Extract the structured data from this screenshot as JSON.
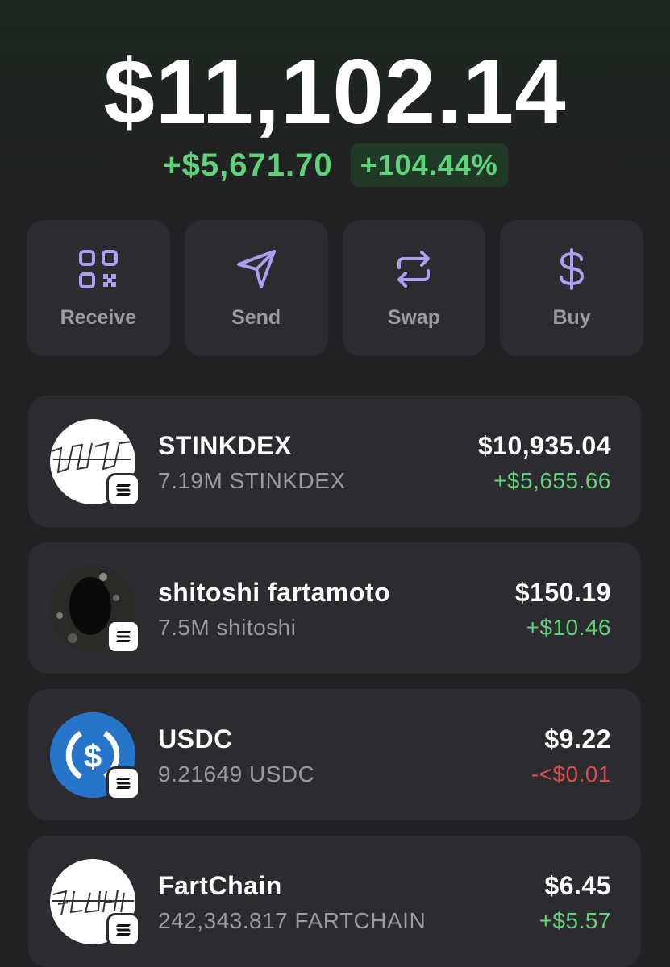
{
  "portfolio": {
    "balance": "$11,102.14",
    "change_abs": "+$5,671.70",
    "change_pct": "+104.44%"
  },
  "actions": [
    {
      "label": "Receive",
      "icon": "qr-code-icon"
    },
    {
      "label": "Send",
      "icon": "send-icon"
    },
    {
      "label": "Swap",
      "icon": "swap-icon"
    },
    {
      "label": "Buy",
      "icon": "dollar-icon"
    }
  ],
  "tokens": [
    {
      "name": "STINKDEX",
      "amount": "7.19M STINKDEX",
      "value": "$10,935.04",
      "change": "+$5,655.66",
      "change_dir": "up"
    },
    {
      "name": "shitoshi fartamoto",
      "amount": "7.5M shitoshi",
      "value": "$150.19",
      "change": "+$10.46",
      "change_dir": "up"
    },
    {
      "name": "USDC",
      "amount": "9.21649 USDC",
      "value": "$9.22",
      "change": "-<$0.01",
      "change_dir": "down"
    },
    {
      "name": "FartChain",
      "amount": "242,343.817 FARTCHAIN",
      "value": "$6.45",
      "change": "+$5.57",
      "change_dir": "up"
    }
  ],
  "colors": {
    "positive": "#5fd37a",
    "negative": "#e04a4a",
    "accent": "#ab9ff2",
    "usdc_blue": "#2775ca"
  },
  "chain_badge_icon": "solana-icon"
}
